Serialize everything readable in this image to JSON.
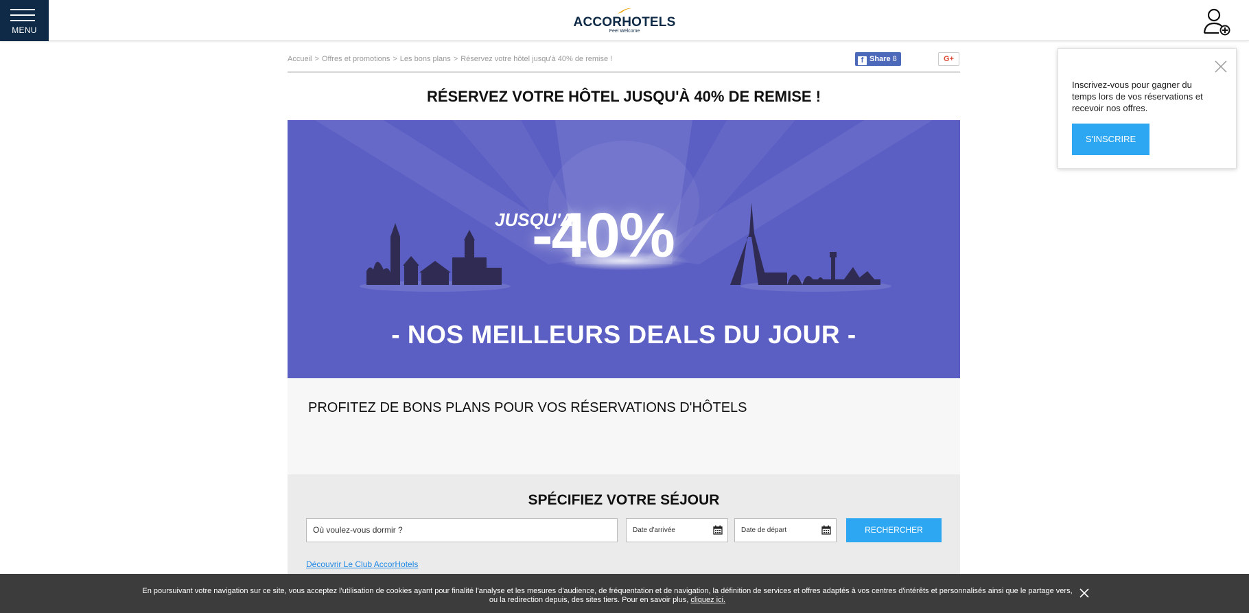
{
  "header": {
    "menu_label": "MENU",
    "logo_brand": "ACCORHOTELS",
    "logo_tagline": "Feel Welcome"
  },
  "breadcrumb": {
    "items": [
      "Accueil",
      "Offres et promotions",
      "Les bons plans",
      "Réservez votre hôtel jusqu'à 40% de remise !"
    ],
    "separator": ">"
  },
  "social": {
    "fb_label": "Share",
    "fb_count": "8",
    "gplus_label": "G+"
  },
  "page_title": "RÉSERVEZ VOTRE HÔTEL JUSQU'À 40% DE REMISE !",
  "banner": {
    "jusqua": "JUSQU'A",
    "percent": "-40%",
    "deals": "- NOS MEILLEURS DEALS DU JOUR -",
    "bg_color": "#5b5ec3"
  },
  "promo": {
    "heading": "PROFITEZ DE BONS PLANS POUR VOS RÉSERVATIONS D'HÔTELS"
  },
  "search": {
    "title": "SPÉCIFIEZ VOTRE SÉJOUR",
    "where_placeholder": "Où voulez-vous dormir ?",
    "arrival_placeholder": "Date d'arrivée",
    "departure_placeholder": "Date de départ",
    "button_label": "RECHERCHER",
    "club_link": "Découvrir Le Club AccorHotels"
  },
  "popup": {
    "message": "Inscrivez-vous pour gagner du temps lors de vos réservations et recevoir nos offres.",
    "button_label": "S'INSCRIRE"
  },
  "cookie": {
    "text": "En poursuivant votre navigation sur ce site, vous acceptez l'utilisation de cookies ayant pour finalité l'analyse et les mesures d'audience, de fréquentation et de navigation, la définition de services et offres adaptés à vos centres d'intérêts et personnalisés ainsi que le partage vers, ou la redirection depuis, des sites tiers. Pour en savoir plus,",
    "link": "cliquez ici."
  },
  "colors": {
    "navy": "#0e2a47",
    "accent_blue": "#2ea7f2",
    "banner": "#5b5ec3",
    "logo_gold": "#e8a200"
  }
}
